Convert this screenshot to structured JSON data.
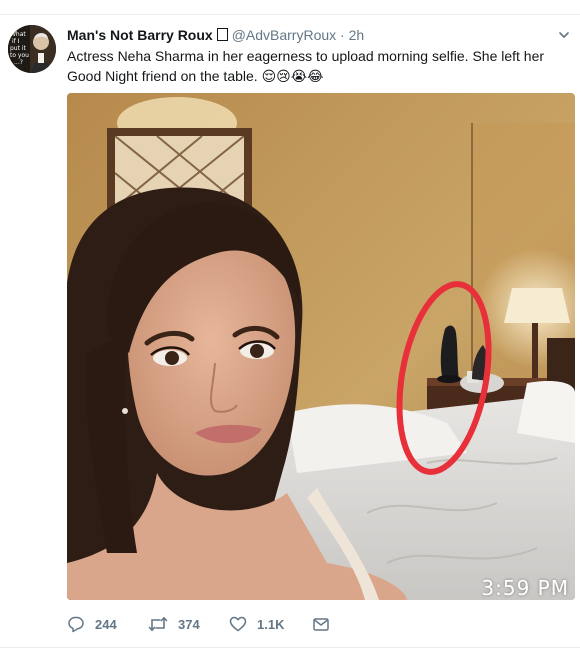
{
  "tweet": {
    "display_name": "Man's Not Barry Roux",
    "verified_glyph": "",
    "handle": "@AdvBarryRoux",
    "separator": "·",
    "time": "2h",
    "text": "Actress Neha Sharma in her eagerness to upload morning selfie. She left her Good Night friend on the table.",
    "emojis": "😌😢😭😂",
    "avatar_text": "What if I put it to you...?",
    "media": {
      "overlay_time": "3:59 PM",
      "annotation_color": "#e8303a"
    },
    "actions": {
      "reply_count": "244",
      "retweet_count": "374",
      "like_count": "1.1K"
    },
    "icons": {
      "reply": "reply-icon",
      "retweet": "retweet-icon",
      "like": "heart-icon",
      "dm": "envelope-icon",
      "more": "chevron-down-icon"
    },
    "colors": {
      "text": "#14171a",
      "secondary": "#657786",
      "border": "#e6ecf0"
    }
  }
}
